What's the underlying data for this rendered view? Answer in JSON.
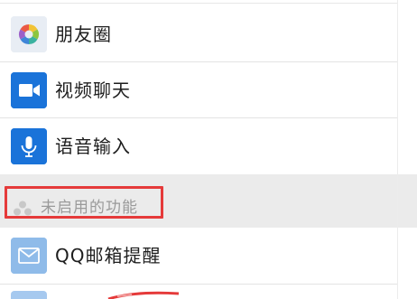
{
  "features": {
    "enabled": [
      {
        "label": "朋友圈",
        "icon": "moments-icon"
      },
      {
        "label": "视频聊天",
        "icon": "video-camera-icon"
      },
      {
        "label": "语音输入",
        "icon": "microphone-icon"
      }
    ],
    "disabled_section": {
      "title": "未启用的功能",
      "icon": "group-icon"
    },
    "disabled": [
      {
        "label": "QQ邮箱提醒",
        "icon": "mail-icon"
      }
    ]
  },
  "colors": {
    "icon_blue": "#1a73d9",
    "icon_light_blue": "#8fbbe9",
    "highlight_red": "#e53a3a",
    "section_bg": "#ebebeb",
    "disabled_text": "#9a9a9a"
  }
}
